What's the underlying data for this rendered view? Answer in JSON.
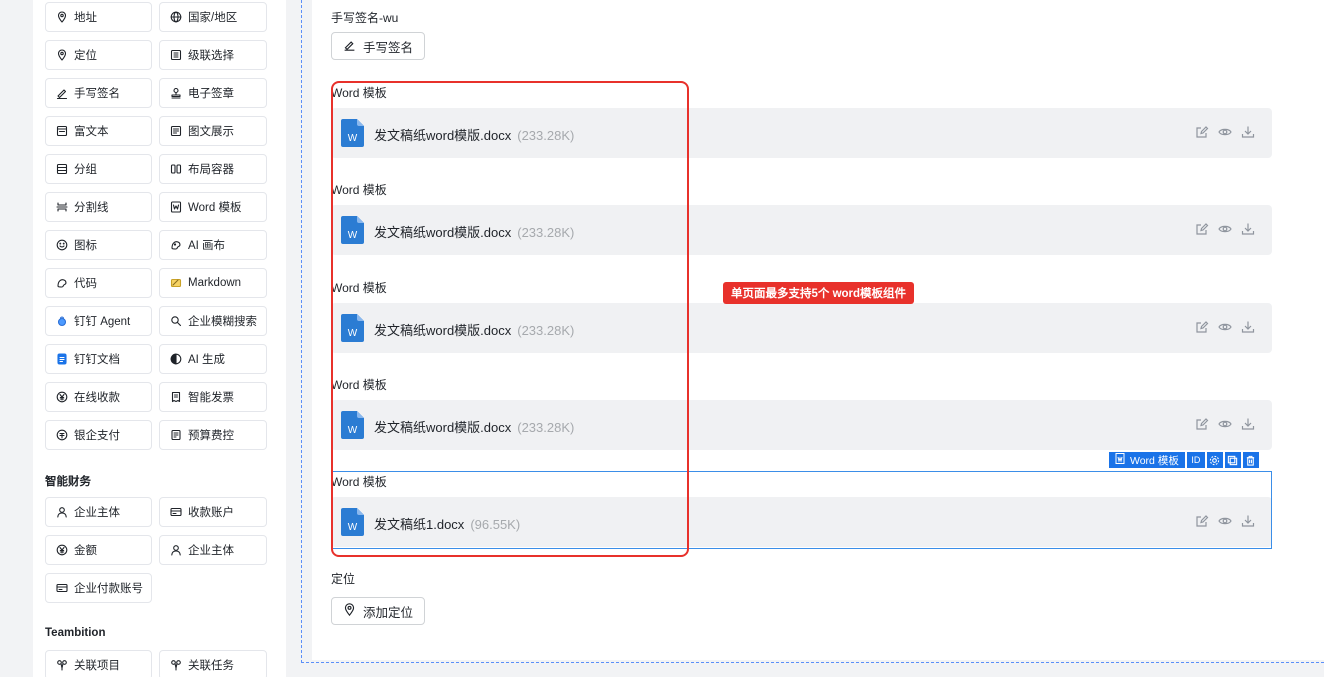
{
  "palette": {
    "grid_top": [
      {
        "label": "地址",
        "icon": "location-icon"
      },
      {
        "label": "国家/地区",
        "icon": "globe-icon"
      },
      {
        "label": "定位",
        "icon": "pin-icon"
      },
      {
        "label": "级联选择",
        "icon": "cascade-icon"
      },
      {
        "label": "手写签名",
        "icon": "signature-icon"
      },
      {
        "label": "电子签章",
        "icon": "stamp-icon"
      },
      {
        "label": "富文本",
        "icon": "richtext-icon"
      },
      {
        "label": "图文展示",
        "icon": "image-text-icon"
      },
      {
        "label": "分组",
        "icon": "group-icon"
      },
      {
        "label": "布局容器",
        "icon": "layout-icon"
      },
      {
        "label": "分割线",
        "icon": "divider-icon"
      },
      {
        "label": "Word 模板",
        "icon": "word-icon"
      },
      {
        "label": "图标",
        "icon": "smile-icon"
      },
      {
        "label": "AI 画布",
        "icon": "ai-canvas-icon"
      },
      {
        "label": "代码",
        "icon": "code-icon"
      },
      {
        "label": "Markdown",
        "icon": "markdown-icon"
      },
      {
        "label": "钉钉 Agent",
        "icon": "agent-icon"
      },
      {
        "label": "企业模糊搜索",
        "icon": "search-icon"
      },
      {
        "label": "钉钉文档",
        "icon": "doc-icon"
      },
      {
        "label": "AI 生成",
        "icon": "ai-generate-icon"
      },
      {
        "label": "在线收款",
        "icon": "yen-icon"
      },
      {
        "label": "智能发票",
        "icon": "invoice-icon"
      },
      {
        "label": "银企支付",
        "icon": "bank-pay-icon"
      },
      {
        "label": "预算费控",
        "icon": "budget-icon"
      }
    ],
    "section_finance": "智能财务",
    "grid_finance": [
      {
        "label": "企业主体",
        "icon": "user-icon"
      },
      {
        "label": "收款账户",
        "icon": "card-icon"
      },
      {
        "label": "金额",
        "icon": "yen-icon"
      },
      {
        "label": "企业主体",
        "icon": "user-icon"
      },
      {
        "label": "企业付款账号",
        "icon": "card-icon"
      }
    ],
    "section_teambition": "Teambition",
    "grid_teambition": [
      {
        "label": "关联项目",
        "icon": "link-project-icon"
      },
      {
        "label": "关联任务",
        "icon": "link-task-icon"
      }
    ]
  },
  "canvas": {
    "signature_label": "手写签名-wu",
    "signature_button": "手写签名",
    "word_fields": [
      {
        "label": "Word 模板",
        "file": "发文稿纸word模版.docx",
        "size": "(233.28K)"
      },
      {
        "label": "Word 模板",
        "file": "发文稿纸word模版.docx",
        "size": "(233.28K)"
      },
      {
        "label": "Word 模板",
        "file": "发文稿纸word模版.docx",
        "size": "(233.28K)"
      },
      {
        "label": "Word 模板",
        "file": "发文稿纸word模版.docx",
        "size": "(233.28K)"
      },
      {
        "label": "Word 模板",
        "file": "发文稿纸1.docx",
        "size": "(96.55K)"
      }
    ],
    "selected_toolbar": {
      "name": "Word 模板",
      "id_label": "ID"
    },
    "location_label": "定位",
    "location_button": "添加定位",
    "annotation": "单页面最多支持5个 word模板组件"
  },
  "colors": {
    "accent": "#1a73e8",
    "annotation": "#e8312b",
    "card_bg": "#f0f1f3",
    "word_blue": "#2b7cd3"
  }
}
